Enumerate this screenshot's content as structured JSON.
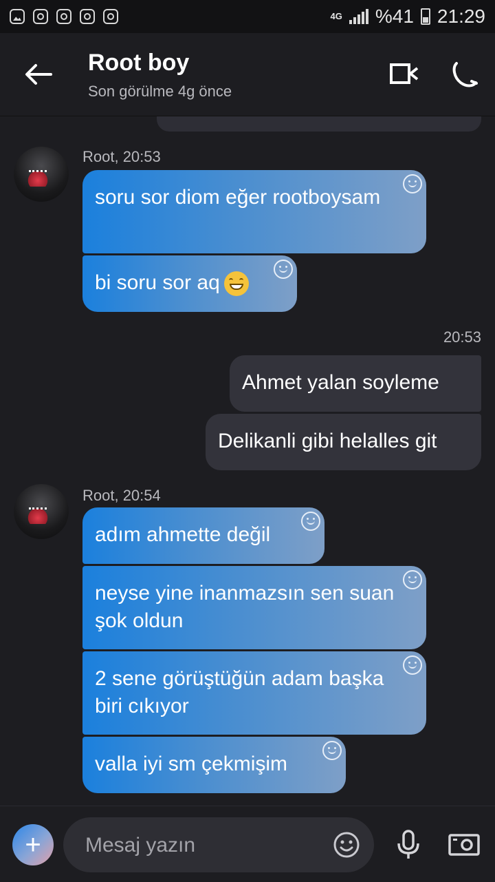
{
  "status_bar": {
    "network": "4G",
    "battery": "%41",
    "time": "21:29",
    "notification_icons": [
      "gallery-icon",
      "instagram-icon",
      "instagram-icon",
      "instagram-icon",
      "instagram-icon"
    ]
  },
  "header": {
    "contact_name": "Root boy",
    "last_seen": "Son görülme 4g önce"
  },
  "messages": {
    "group1": {
      "meta": "Root, 20:53",
      "m1": "soru sor diom eğer rootboysam",
      "m2": "bi soru sor aq"
    },
    "group2": {
      "meta": "20:53",
      "m1": "Ahmet yalan soyleme",
      "m2": "Delikanli gibi helalles git"
    },
    "group3": {
      "meta": "Root, 20:54",
      "m1": "adım ahmette değil",
      "m2": "neyse yine inanmazsın sen suan şok oldun",
      "m3": "2 sene görüştüğün adam başka biri cıkıyor",
      "m4": "valla iyi sm çekmişim"
    }
  },
  "composer": {
    "placeholder": "Mesaj yazın",
    "plus": "+"
  },
  "colors": {
    "background": "#1d1d21",
    "incoming_start": "#1b80dd",
    "incoming_end": "#7e9fc7",
    "outgoing": "#33333b"
  }
}
